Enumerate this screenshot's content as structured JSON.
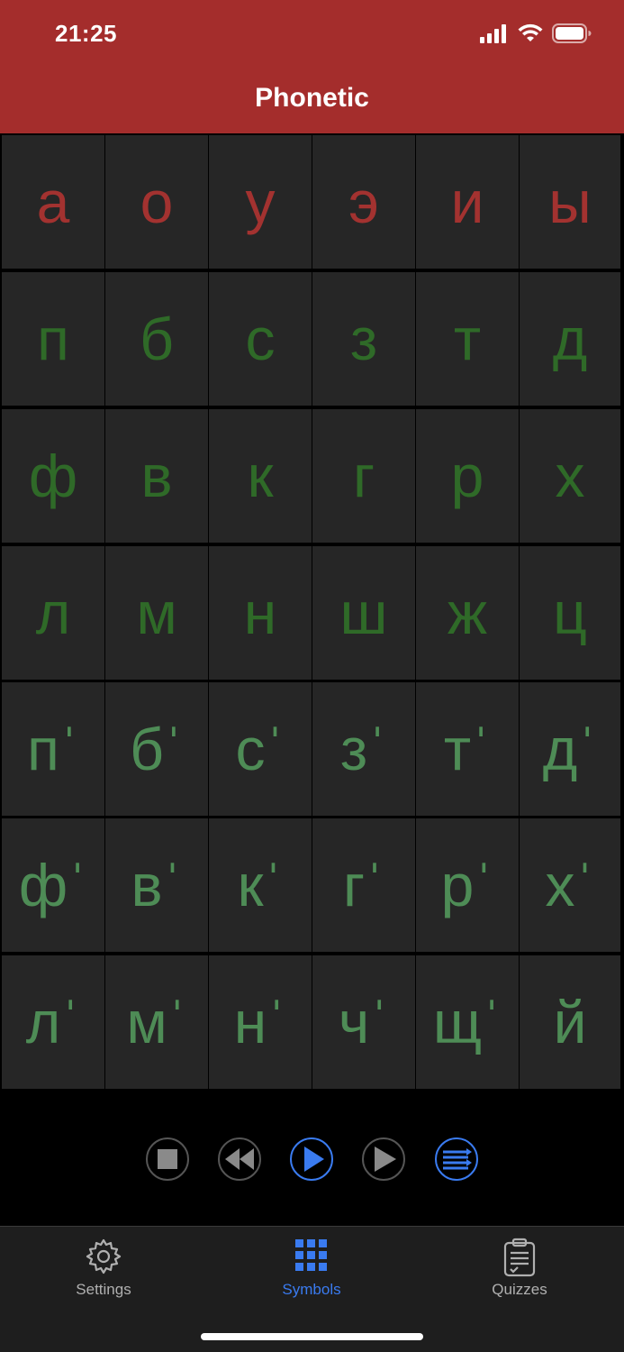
{
  "status": {
    "time": "21:25"
  },
  "header": {
    "title": "Phonetic"
  },
  "grid": {
    "rows": [
      {
        "kind": "vowel",
        "cells": [
          "а",
          "о",
          "у",
          "э",
          "и",
          "ы"
        ]
      },
      {
        "kind": "consonant",
        "cells": [
          "п",
          "б",
          "с",
          "з",
          "т",
          "д"
        ]
      },
      {
        "kind": "consonant",
        "cells": [
          "ф",
          "в",
          "к",
          "г",
          "р",
          "х"
        ]
      },
      {
        "kind": "consonant",
        "cells": [
          "л",
          "м",
          "н",
          "ш",
          "ж",
          "ц"
        ]
      },
      {
        "kind": "soft",
        "cells": [
          "пˈ",
          "бˈ",
          "сˈ",
          "зˈ",
          "тˈ",
          "дˈ"
        ]
      },
      {
        "kind": "soft",
        "cells": [
          "фˈ",
          "вˈ",
          "кˈ",
          "гˈ",
          "рˈ",
          "хˈ"
        ]
      },
      {
        "kind": "soft",
        "cells": [
          "лˈ",
          "мˈ",
          "нˈ",
          "чˈ",
          "щˈ",
          "й"
        ]
      }
    ]
  },
  "player": {
    "buttons": [
      "stop-icon",
      "rewind-icon",
      "play-icon",
      "forward-icon",
      "playlist-icon"
    ]
  },
  "tabs": [
    {
      "label": "Settings",
      "icon": "gear-icon",
      "active": false
    },
    {
      "label": "Symbols",
      "icon": "grid-icon",
      "active": true
    },
    {
      "label": "Quizzes",
      "icon": "clipboard-icon",
      "active": false
    }
  ],
  "colors": {
    "header": "#a42d2c",
    "vowel": "#a33230",
    "consonant": "#2f6a28",
    "soft": "#4e8c56",
    "accent": "#3a7bf0"
  }
}
